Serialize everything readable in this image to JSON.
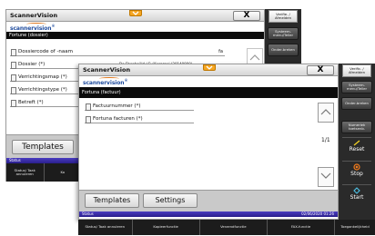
{
  "window1": {
    "title": "ScannerVision",
    "close_label": "X",
    "logo": "scannervision",
    "logo_mark": "®",
    "section": "Fortune (dossier)",
    "fields": [
      {
        "label": "Dossiercode of -naam",
        "value": "fa"
      },
      {
        "label": "Dossier (*)",
        "value": "De Ebenhoëld / Evilliersgasi (20140090)"
      },
      {
        "label": "Verrichtingsmap (*)",
        "value": ""
      },
      {
        "label": "Verrichtingstype (*)",
        "value": ""
      },
      {
        "label": "Betreft (*)",
        "value": ""
      }
    ],
    "templates_label": "Templates",
    "status_label": "Status",
    "footer": [
      "Status/ Taak annuleren",
      "Ko"
    ]
  },
  "window2": {
    "title": "ScannerVision",
    "close_label": "X",
    "logo": "scannervision",
    "logo_mark": "®",
    "section": "Fortuna (factuur)",
    "fields": [
      {
        "label": "Factuurnummer (*)"
      },
      {
        "label": "Fortuna facturen (*)"
      }
    ],
    "page_counter": "1/1",
    "templates_label": "Templates",
    "settings_label": "Settings",
    "status_label": "Status",
    "datetime": "02/06/2020  01:26",
    "footer": [
      "Status/ Taak annuleren",
      "Kopieerfunctie",
      "Verzendfunctie",
      "FAX-functie",
      "Toegankelijkheid"
    ]
  },
  "sidepanel1": {
    "login": "Verifie. / Afmelden",
    "menu": "Systeem-menu/Teller",
    "interrupt": "Onder-breken"
  },
  "sidepanel2": {
    "login": "Verific. / Afmelden",
    "menu": "Systeem-menu/Teller",
    "interrupt": "Onder-breken",
    "numeric": "Numeriek toetsenb.",
    "reset": "Reset",
    "stop": "Stop",
    "start": "Start"
  },
  "colors": {
    "accent_orange": "#f5a623",
    "status_blue": "#3a2fb0",
    "logo_blue": "#1f4c9e",
    "reset_yellow": "#f2d024",
    "stop_orange": "#f07a1c",
    "start_cyan": "#4fc3e8"
  },
  "icons": {
    "expand": "chevron-down-icon",
    "scroll_up": "chevron-up-icon",
    "scroll_down": "chevron-down-icon",
    "reset": "reset-icon",
    "stop": "stop-icon",
    "start": "start-icon"
  }
}
